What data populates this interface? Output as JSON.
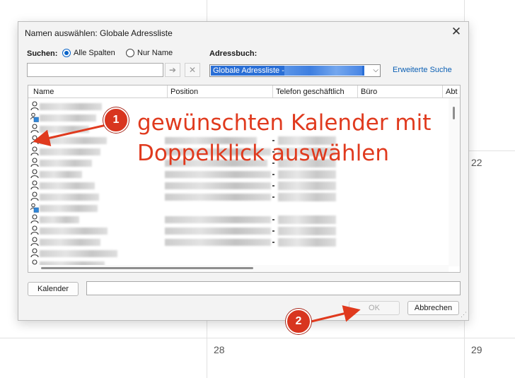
{
  "calendar": {
    "day_22": "22",
    "day_28": "28",
    "day_29": "29"
  },
  "dialog": {
    "title": "Namen auswählen: Globale Adressliste",
    "close_glyph": "✕",
    "search_label": "Suchen:",
    "radio_all": "Alle Spalten",
    "radio_name": "Nur Name",
    "search_value": "",
    "go_glyph": "➔",
    "clear_glyph": "✕",
    "addressbook_label": "Adressbuch:",
    "addressbook_value": "Globale Adressliste -",
    "dropdown_glyph": "⌵",
    "advanced_search": "Erweiterte Suche",
    "columns": [
      "Name",
      "Position",
      "Telefon geschäftlich",
      "Büro",
      "Abt"
    ],
    "calendar_button": "Kalender",
    "calendar_input_value": "",
    "ok_button": "OK",
    "cancel_button": "Abbrechen",
    "resize_grip": "⋰"
  },
  "annotations": {
    "badge_1": "1",
    "badge_2": "2",
    "line_1": "gewünschten Kalender mit",
    "line_2": "Doppelklick auswählen",
    "color": "#e03a1e"
  },
  "rows": [
    {
      "icon": "person-icon"
    },
    {
      "icon": "room-icon"
    },
    {
      "icon": "person-icon"
    },
    {
      "icon": "person-icon"
    },
    {
      "icon": "person-icon"
    },
    {
      "icon": "person-icon"
    },
    {
      "icon": "person-icon"
    },
    {
      "icon": "person-icon"
    },
    {
      "icon": "person-icon"
    },
    {
      "icon": "room-icon"
    },
    {
      "icon": "person-icon"
    },
    {
      "icon": "person-icon"
    },
    {
      "icon": "person-icon"
    },
    {
      "icon": "person-icon"
    },
    {
      "icon": "person-icon"
    },
    {
      "icon": "person-icon"
    }
  ]
}
